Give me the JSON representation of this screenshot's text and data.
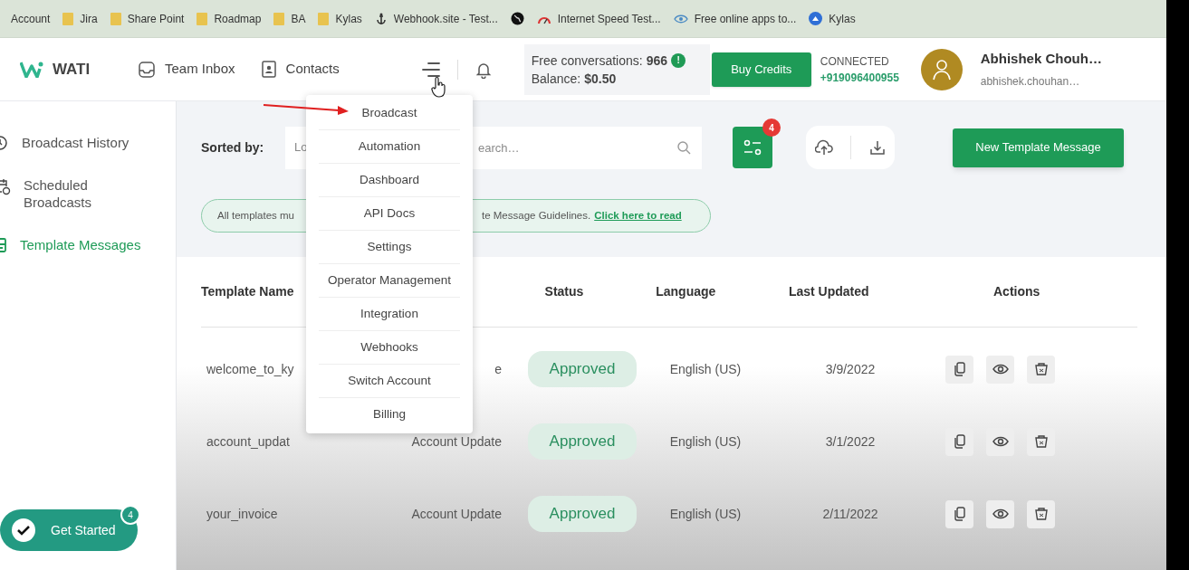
{
  "bookmarks": [
    {
      "label": "Account",
      "kind": "none"
    },
    {
      "label": "Jira",
      "kind": "folder"
    },
    {
      "label": "Share Point",
      "kind": "folder"
    },
    {
      "label": "Roadmap",
      "kind": "folder"
    },
    {
      "label": "BA",
      "kind": "folder"
    },
    {
      "label": "Kylas",
      "kind": "folder"
    },
    {
      "label": "Webhook.site - Test...",
      "kind": "anchor"
    },
    {
      "kind": "globe"
    },
    {
      "label": "Internet Speed Test...",
      "kind": "gauge"
    },
    {
      "label": "Free online apps to...",
      "kind": "eye"
    },
    {
      "label": "Kylas",
      "kind": "bluelogo"
    }
  ],
  "header": {
    "logo": "WATI",
    "nav": [
      {
        "label": "Team Inbox",
        "kind": "inbox"
      },
      {
        "label": "Contacts",
        "kind": "contacts"
      }
    ],
    "credits": {
      "conversations_label": "Free conversations:",
      "conversations": "966",
      "info": "!",
      "balance_label": "Balance:",
      "balance": "$0.50"
    },
    "buy_button": "Buy Credits",
    "connection": {
      "status": "CONNECTED",
      "phone": "+919096400955"
    },
    "user": {
      "name": "Abhishek Chouh…",
      "email": "abhishek.chouhan…"
    }
  },
  "sidebar": {
    "items": [
      {
        "label": "Broadcast History",
        "kind": "clock",
        "selected": false
      },
      {
        "label": "Scheduled Broadcasts",
        "kind": "calendar",
        "selected": false
      },
      {
        "label": "Template Messages",
        "kind": "template",
        "selected": true
      }
    ]
  },
  "toolbar": {
    "sort_label": "Sorted by:",
    "sort_value": "Lo",
    "search": {
      "placeholder": "earch…"
    },
    "filter_badge": "4",
    "new_button": "New Template Message"
  },
  "banner": {
    "text_start": "All templates mu",
    "text_end": "te Message Guidelines.",
    "link": "Click here to read"
  },
  "table": {
    "columns": [
      "Template Name",
      "Status",
      "Language",
      "Last Updated",
      "Actions"
    ],
    "rows": [
      {
        "name": "welcome_to_ky",
        "category": "e",
        "status": "Approved",
        "language": "English (US)",
        "updated": "3/9/2022"
      },
      {
        "name": "account_updat",
        "category": "Account Update",
        "status": "Approved",
        "language": "English (US)",
        "updated": "3/1/2022"
      },
      {
        "name": "your_invoice",
        "category": "Account Update",
        "status": "Approved",
        "language": "English (US)",
        "updated": "2/11/2022"
      }
    ]
  },
  "menu": {
    "items": [
      "Broadcast",
      "Automation",
      "Dashboard",
      "API Docs",
      "Settings",
      "Operator Management",
      "Integration",
      "Webhooks",
      "Switch Account",
      "Billing"
    ]
  },
  "get_started": {
    "label": "Get Started",
    "badge": "4"
  }
}
